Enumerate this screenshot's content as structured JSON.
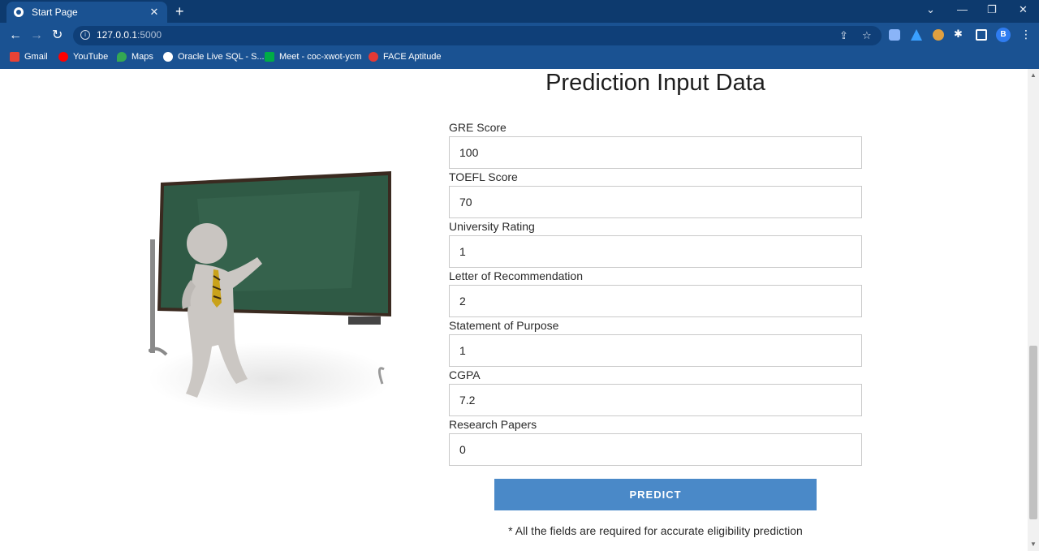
{
  "browser": {
    "tab_title": "Start Page",
    "tab_close": "✕",
    "new_tab": "+",
    "url_host": "127.0.0.1",
    "url_port": ":5000",
    "profile_initial": "B",
    "bookmarks": [
      {
        "label": "Gmail",
        "color": "#ea4335"
      },
      {
        "label": "YouTube",
        "color": "#ff0000"
      },
      {
        "label": "Maps",
        "color": "#34a853"
      },
      {
        "label": "Oracle Live SQL - S...",
        "color": "#ffffff"
      },
      {
        "label": "Meet - coc-xwot-ycm",
        "color": "#00ac47"
      },
      {
        "label": "FACE Aptitude",
        "color": "#e53935"
      }
    ]
  },
  "page": {
    "heading": "Prediction Input Data",
    "fields": [
      {
        "label": "GRE Score",
        "value": "100"
      },
      {
        "label": "TOEFL Score",
        "value": "70"
      },
      {
        "label": "University Rating",
        "value": "1"
      },
      {
        "label": "Letter of Recommendation",
        "value": "2"
      },
      {
        "label": "Statement of Purpose",
        "value": "1"
      },
      {
        "label": "CGPA",
        "value": "7.2"
      },
      {
        "label": "Research Papers",
        "value": "0"
      }
    ],
    "predict_label": "PREDICT",
    "note": "* All the fields are required for accurate eligibility prediction"
  },
  "colors": {
    "accent": "#4a89c8",
    "browser_chrome": "#1a5292",
    "chalkboard": "#2f5a45"
  }
}
